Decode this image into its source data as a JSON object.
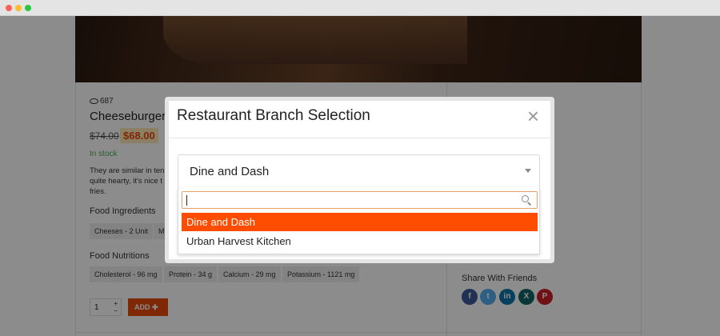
{
  "product": {
    "views": "687",
    "title": "Cheeseburger",
    "old_price": "$74.00",
    "new_price": "$68.00",
    "stock": "In stock",
    "description": "They are similar in ten\nquite hearty, it's nice t\nfries.",
    "ingredients_title": "Food Ingredients",
    "ingredients": [
      "Cheeses - 2 Unit",
      "M"
    ],
    "nutritions_title": "Food Nutritions",
    "nutritions": [
      "Cholesterol - 96 mg",
      "Protein - 34 g",
      "Calcium - 29 mg",
      "Potassium - 1121 mg"
    ],
    "quantity": "1",
    "add_label": "ADD"
  },
  "share": {
    "title": "Share With Friends",
    "networks": [
      {
        "icon": "facebook-icon",
        "glyph": "f",
        "color": "#3b5998"
      },
      {
        "icon": "twitter-icon",
        "glyph": "t",
        "color": "#55acee"
      },
      {
        "icon": "linkedin-icon",
        "glyph": "in",
        "color": "#0e76a8"
      },
      {
        "icon": "xing-icon",
        "glyph": "X",
        "color": "#126567"
      },
      {
        "icon": "pinterest-icon",
        "glyph": "P",
        "color": "#cb2027"
      }
    ]
  },
  "modal": {
    "title": "Restaurant Branch Selection",
    "close": "×",
    "selected": "Dine and Dash",
    "search_value": "",
    "options": [
      "Dine and Dash",
      "Urban Harvest Kitchen"
    ]
  },
  "colors": {
    "accent": "#ff4d00",
    "price": "#e8480c"
  }
}
